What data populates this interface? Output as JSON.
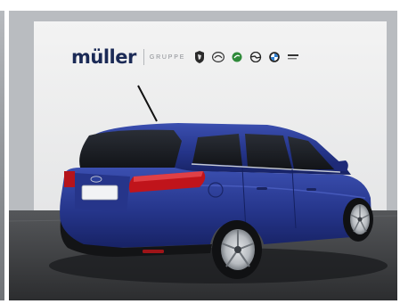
{
  "dealer": {
    "logo_text": "müller",
    "group_text": "GRUPPE"
  },
  "brand_marks": [
    {
      "icon": "peugeot-lion-icon"
    },
    {
      "icon": "mazda-icon"
    },
    {
      "icon": "skoda-icon"
    },
    {
      "icon": "opel-icon"
    },
    {
      "icon": "bmw-icon"
    },
    {
      "icon": "bmw-service-icon"
    }
  ],
  "car": {
    "color": "#2a3a8c",
    "brand_badge_icon": "ford-oval-icon"
  },
  "colors": {
    "wall": "#eeeeee",
    "floor": "#3a3b3d",
    "logo": "#1b2a56"
  }
}
